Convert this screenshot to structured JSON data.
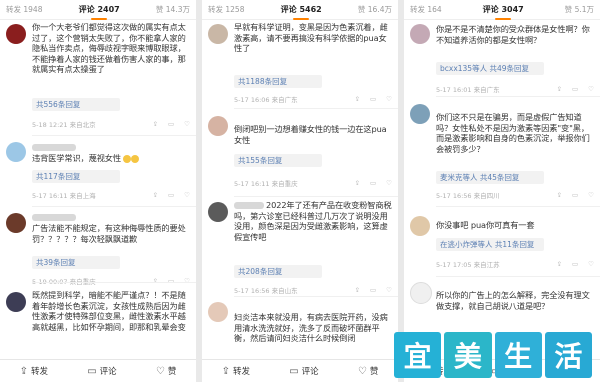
{
  "panels": [
    {
      "tabs": {
        "repost": "转发 1948",
        "comment": "评论 2407",
        "like": "赞",
        "count": "14.3万"
      },
      "comments": [
        {
          "text": "你一个大老爷们都觉得这次做的属实有点太过了，这个营销太失败了，你不能拿人家的隐私当作卖点，侮辱歧视字眼来博取眼球，不能挣着人家的钱还做着伤害人家的事，那就属实有点太操蛋了",
          "reply": "共556条回复",
          "meta": "5-18 12:21 来自北京"
        },
        {
          "text": "违背医学常识，蔑视女性",
          "reply": "共117条回复",
          "meta": "5-17 16:11 来自上海"
        },
        {
          "text": "广告法能不能规定，有这种侮辱性质的要处罚？？？？？每次轻飘飘道歉",
          "reply": "共39条回复",
          "meta": "5-19 00:07 来自重庆"
        },
        {
          "text": "既然提到科学，暗能不能严谨点？！不是随着年龄增长色素沉淀，女孩性成熟后因为雌性激素才使特殊部位变黑，雌性激素水平越高就越黑，比如怀孕期间，即那和乳晕会变",
          "reply": "",
          "meta": ""
        }
      ]
    },
    {
      "tabs": {
        "repost": "转发 1258",
        "comment": "评论 5462",
        "like": "赞",
        "count": "16.4万"
      },
      "comments": [
        {
          "text": "早就有科学证明，变黑是因为色素沉着，雌激素高，请不要再搞没有科学依据的pua女性了",
          "reply": "共1188条回复",
          "meta": "5-17 16:06 来自广东"
        },
        {
          "text": "倒闭吧别一边想着赚女性的钱一边在这pua女性",
          "reply": "共155条回复",
          "meta": "5-17 16:11 来自重庆"
        },
        {
          "text": "2022年了还有产品在收变粉智商税吗，第六诊室已经科普过几万次了说明没用没用，颜色深是因为受雌激素影响，这算虚假宣传吧",
          "reply": "共208条回复",
          "meta": "5-17 16:56 来自山东"
        },
        {
          "text": "妇炎洁本来就没用，有病去医院开药，没病用清水洗洗就好，洗多了反而破坏菌群平衡，然后请问妇炎洁什么时候倒闭",
          "reply": "",
          "meta": ""
        }
      ]
    },
    {
      "tabs": {
        "repost": "转发 164",
        "comment": "评论 3047",
        "like": "赞",
        "count": "5.1万"
      },
      "comments": [
        {
          "text": "你是不是不清楚你的受众群体是女性啊？你不知道养活你的都是女性啊？",
          "reply": "bcxx135等人  共49条回复",
          "meta": "5-17 16:01 来自广东"
        },
        {
          "text": "你们这不只是在骗男，而是虚假广告知道吗？女性私处不是因为激素等因素\"变\"黑，而是激素影响和自身的色素沉淀，举报你们会被罚多少？",
          "reply": "麦米克等人  共45条回复",
          "meta": "5-17 16:56 来自四川"
        },
        {
          "text": "你没事吧 pua你可真有一套",
          "reply": "在逃小炸弹等人  共11条回复",
          "meta": "5-17 17:05 来自江苏"
        },
        {
          "text": "所以你的广告上的怎么解释，完全没有理文做支撑，就自己胡说八道是吧？",
          "reply": "",
          "meta": ""
        }
      ]
    }
  ],
  "bottom_bar": {
    "repost": "转发",
    "comment": "评论",
    "like": "赞"
  },
  "watermark": [
    "宜",
    "美",
    "生",
    "活"
  ],
  "colors": {
    "accent": "#ff8200",
    "link": "#5b7fb3",
    "watermark_bg": "#25b1d6"
  }
}
